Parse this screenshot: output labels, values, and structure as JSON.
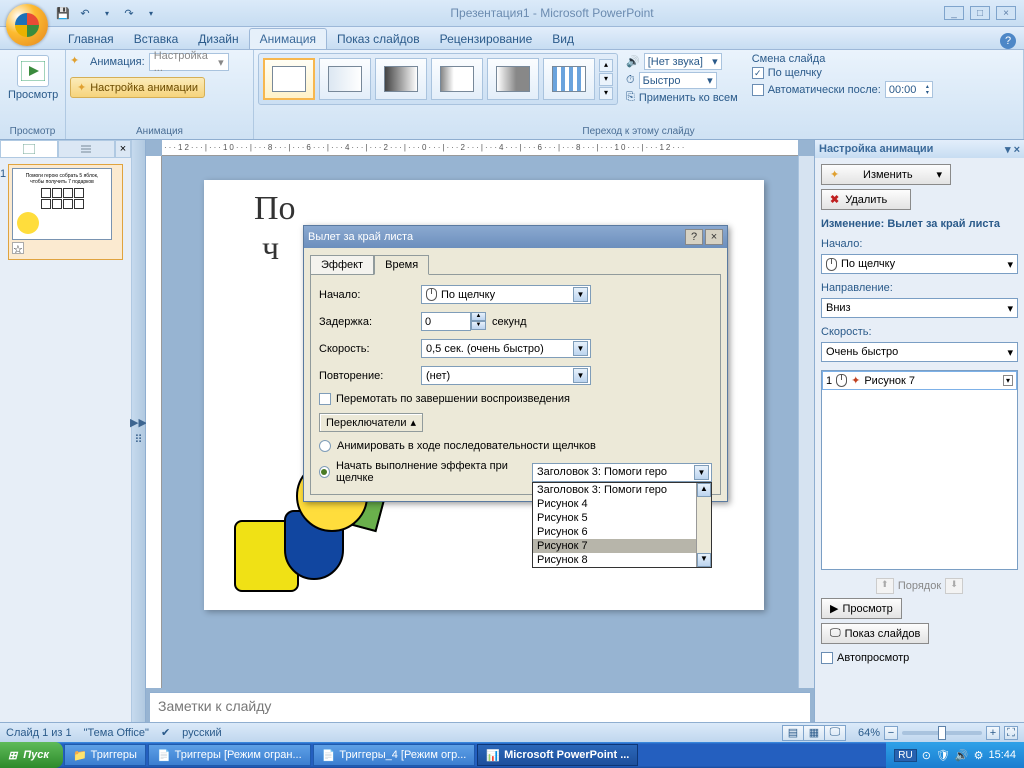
{
  "window": {
    "title": "Презентация1 - Microsoft PowerPoint"
  },
  "qat": {
    "save": "💾",
    "undo": "↶",
    "redo": "↷"
  },
  "tabs": {
    "home": "Главная",
    "insert": "Вставка",
    "design": "Дизайн",
    "animation": "Анимация",
    "slideshow": "Показ слайдов",
    "review": "Рецензирование",
    "view": "Вид"
  },
  "ribbon": {
    "preview": "Просмотр",
    "preview_group": "Просмотр",
    "anim_label": "Анимация:",
    "anim_value": "Настройка ...",
    "custom_anim": "Настройка анимации",
    "anim_group": "Анимация",
    "sound_label": "[Нет звука]",
    "speed_label": "Быстро",
    "apply_all": "Применить ко всем",
    "advance_title": "Смена слайда",
    "on_click": "По щелчку",
    "auto_after": "Автоматически после:",
    "auto_time": "00:00",
    "trans_group": "Переход к этому слайду"
  },
  "slide": {
    "heading1": "По",
    "heading2": "ч"
  },
  "notes_placeholder": "Заметки к слайду",
  "animpane": {
    "title": "Настройка анимации",
    "change": "Изменить",
    "remove": "Удалить",
    "modify_label": "Изменение: Вылет за край листа",
    "start_label": "Начало:",
    "start_value": "По щелчку",
    "dir_label": "Направление:",
    "dir_value": "Вниз",
    "speed_label": "Скорость:",
    "speed_value": "Очень быстро",
    "item_num": "1",
    "item_name": "Рисунок 7",
    "reorder": "Порядок",
    "play": "Просмотр",
    "slideshow": "Показ слайдов",
    "autoplay": "Автопросмотр"
  },
  "dialog": {
    "title": "Вылет за край листа",
    "tab_effect": "Эффект",
    "tab_timing": "Время",
    "start_label": "Начало:",
    "start_value": "По щелчку",
    "delay_label": "Задержка:",
    "delay_value": "0",
    "delay_unit": "секунд",
    "speed_label": "Скорость:",
    "speed_value": "0,5 сек. (очень быстро)",
    "repeat_label": "Повторение:",
    "repeat_value": "(нет)",
    "rewind": "Перемотать по завершении воспроизведения",
    "triggers_btn": "Переключатели",
    "radio_seq": "Анимировать в ходе последовательности щелчков",
    "radio_trigger": "Начать выполнение эффекта при щелчке",
    "trigger_selected": "Заголовок 3: Помоги геро",
    "options": [
      "Заголовок 3: Помоги геро",
      "Рисунок 4",
      "Рисунок 5",
      "Рисунок 6",
      "Рисунок 7",
      "Рисунок 8"
    ],
    "opt_selected_idx": 4
  },
  "status": {
    "slide_of": "Слайд 1 из 1",
    "theme": "\"Тема Office\"",
    "lang": "русский",
    "zoom": "64%"
  },
  "taskbar": {
    "start": "Пуск",
    "folder": "Триггеры",
    "word1": "Триггеры [Режим огран...",
    "word2": "Триггеры_4 [Режим огр...",
    "ppt": "Microsoft PowerPoint ...",
    "lang": "RU",
    "time": "15:44"
  },
  "ruler": "···12···|···10···|···8···|···6···|···4···|···2···|···0···|···2···|···4···|···6···|···8···|···10···|···12···"
}
